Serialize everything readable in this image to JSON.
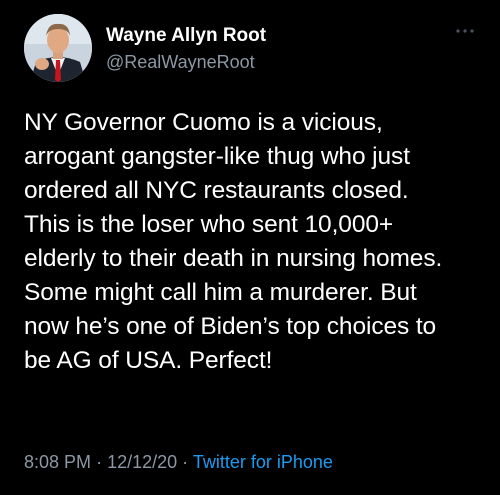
{
  "tweet": {
    "author": {
      "display_name": "Wayne Allyn Root",
      "handle": "@RealWayneRoot",
      "avatar_icon": "profile-photo"
    },
    "more_icon": "ellipsis-icon",
    "text_lines": [
      "NY Governor Cuomo is a vicious,",
      "arrogant gangster-like thug who just",
      "ordered all NYC restaurants closed.",
      "This is the loser who sent 10,000+",
      "elderly to their death in nursing homes.",
      "Some might call him a murderer. But",
      "now he’s one of Biden’s top choices to",
      "be AG of USA. Perfect!"
    ],
    "time": "8:08 PM",
    "separator": "·",
    "date": "12/12/20",
    "source": "Twitter for iPhone"
  },
  "colors": {
    "background": "#000000",
    "text": "#ffffff",
    "secondary": "#8b98a5",
    "link": "#1d9bf0"
  }
}
